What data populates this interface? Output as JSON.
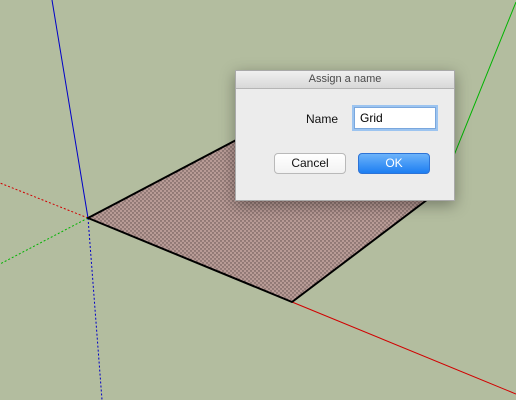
{
  "dialog": {
    "title": "Assign a name",
    "name_label": "Name",
    "name_value": "Grid",
    "cancel_label": "Cancel",
    "ok_label": "OK"
  },
  "scene": {
    "background_color": "#b3bd9f",
    "face_color": "#b89b96",
    "axis_red": "#d10000",
    "axis_green": "#00b400",
    "axis_blue": "#0000c8"
  }
}
